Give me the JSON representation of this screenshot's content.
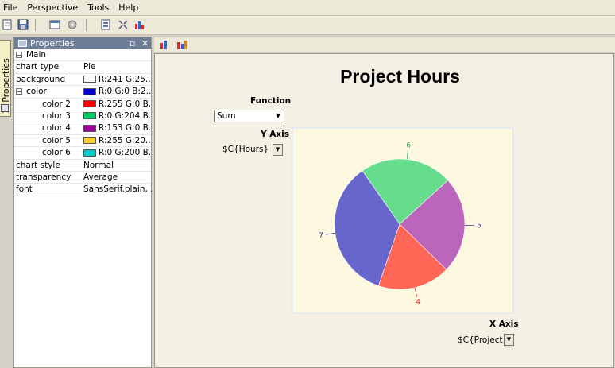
{
  "menu": {
    "file": "File",
    "perspective": "Perspective",
    "tools": "Tools",
    "help": "Help"
  },
  "side_tab": {
    "label": "1: Properties"
  },
  "properties": {
    "title": "Properties",
    "main_label": "Main",
    "rows": {
      "chart_type": {
        "key": "chart type",
        "value": "Pie"
      },
      "background": {
        "key": "background",
        "value": "R:241 G:25..."
      },
      "color": {
        "key": "color",
        "value": "R:0 G:0 B:2..."
      },
      "color2": {
        "key": "color 2",
        "value": "R:255 G:0 B..."
      },
      "color3": {
        "key": "color 3",
        "value": "R:0 G:204 B..."
      },
      "color4": {
        "key": "color 4",
        "value": "R:153 G:0 B..."
      },
      "color5": {
        "key": "color 5",
        "value": "R:255 G:20..."
      },
      "color6": {
        "key": "color 6",
        "value": "R:0 G:200 B..."
      },
      "chart_style": {
        "key": "chart style",
        "value": "Normal"
      },
      "transparency": {
        "key": "transparency",
        "value": "Average"
      },
      "font": {
        "key": "font",
        "value": "SansSerif.plain, ..."
      }
    },
    "swatches": {
      "background": "#f8f8f8",
      "color": "#0000cc",
      "color2": "#ff0000",
      "color3": "#00cc66",
      "color4": "#990099",
      "color5": "#ffcc33",
      "color6": "#00c8c8"
    }
  },
  "chart_panel": {
    "title": "Project Hours",
    "function_label": "Function",
    "function_value": "Sum",
    "y_axis_label": "Y Axis",
    "y_axis_value": "$C{Hours}",
    "x_axis_label": "X Axis",
    "x_axis_value": "$C{Project}"
  },
  "chart_data": {
    "type": "pie",
    "title": "Project Hours",
    "labels": [
      "6",
      "5",
      "4",
      "7"
    ],
    "values": [
      23,
      24,
      18,
      35
    ],
    "colors": [
      "#66dd8c",
      "#bb66bb",
      "#ff6655",
      "#6666cc"
    ],
    "label_colors": [
      "#33aa55",
      "#663399",
      "#dd2222",
      "#333399"
    ],
    "background": "#fdf8e0"
  }
}
